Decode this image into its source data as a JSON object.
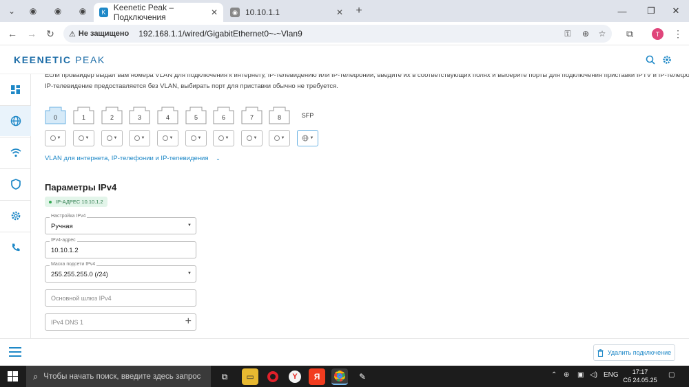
{
  "browser": {
    "tabs": [
      {
        "title": "Keenetic Peak – Подключения",
        "active": true
      },
      {
        "title": "10.10.1.1",
        "active": false
      }
    ],
    "new_tab": "+",
    "security_label": "Не защищено",
    "url": "192.168.1.1/wired/GigabitEthernet0~-~Vlan9",
    "profile_initial": "T"
  },
  "header": {
    "logo_left": "KEENETIC",
    "logo_right": "PEAK"
  },
  "sidebar": {
    "items": [
      {
        "icon": "dashboard-icon"
      },
      {
        "icon": "globe-icon",
        "active": true
      },
      {
        "icon": "wifi-icon"
      },
      {
        "icon": "shield-icon"
      },
      {
        "icon": "gear-icon"
      },
      {
        "icon": "phone-icon"
      }
    ]
  },
  "main": {
    "intro_line1": "Если провайдер выдал вам номера VLAN для подключения к интернету, IP-телевидению или IP-телефонии, введите их в соответствующих полях и выберите порты для подключения приставки IPTV и IP-телефона. Если",
    "intro_line2": "IP-телевидение предоставляется без VLAN, выбирать порт для приставки обычно не требуется.",
    "ports": [
      "0",
      "1",
      "2",
      "3",
      "4",
      "5",
      "6",
      "7",
      "8",
      "SFP"
    ],
    "vlan_link": "VLAN для интернета, IP-телефонии и IP-телевидения",
    "ipv4_title": "Параметры IPv4",
    "ip_badge": "IP-АДРЕС 10.10.1.2",
    "fields": {
      "ipv4_config": {
        "label": "Настройка IPv4",
        "value": "Ручная"
      },
      "ipv4_address": {
        "label": "IPv4-адрес",
        "value": "10.10.1.2"
      },
      "subnet_mask": {
        "label": "Маска подсети IPv4",
        "value": "255.255.255.0 (/24)"
      },
      "gateway": {
        "placeholder": "Основной шлюз IPv4"
      },
      "dns1": {
        "placeholder": "IPv4 DNS 1"
      }
    }
  },
  "bottom": {
    "delete_label": "Удалить подключение"
  },
  "taskbar": {
    "search_placeholder": "Чтобы начать поиск, введите здесь запрос",
    "lang": "ENG",
    "time": "17:17",
    "date": "Сб 24.05.25"
  },
  "colors": {
    "accent": "#1e88c7",
    "logo": "#1e6ea8",
    "badge_bg": "#e3f5ea",
    "badge_text": "#2f7d4f"
  }
}
